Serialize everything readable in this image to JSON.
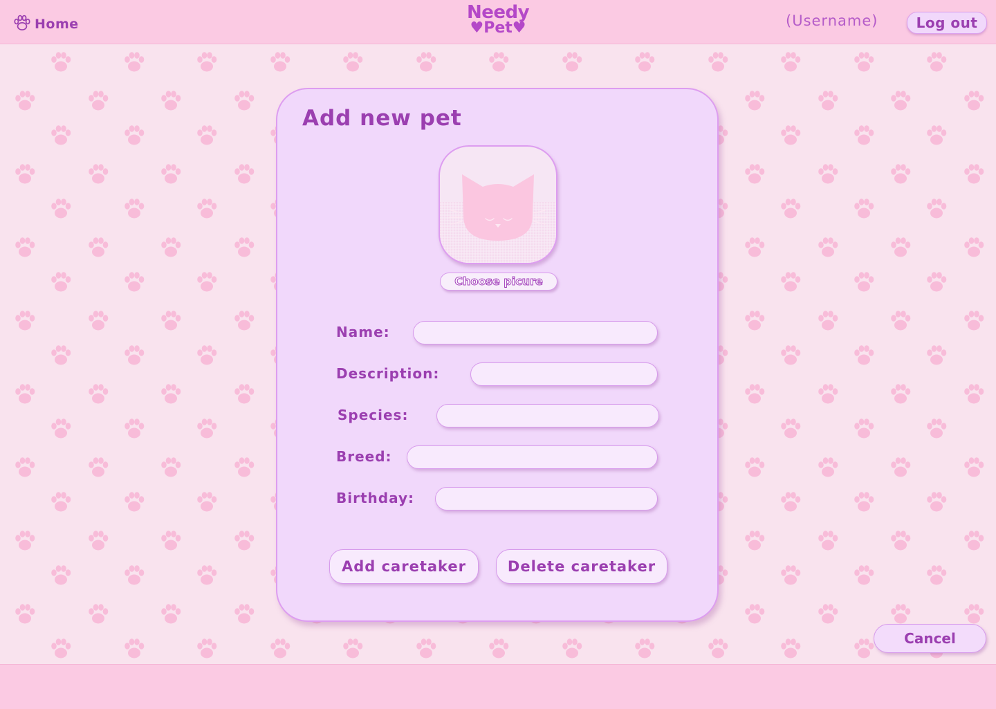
{
  "header": {
    "home_label": "Home",
    "logo_line1": "Needy",
    "logo_line2": "♥Pet♥",
    "username": "(Username)",
    "logout_label": "Log out"
  },
  "form": {
    "title": "Add new pet",
    "choose_picture_label": "Choose picure",
    "fields": [
      {
        "label": "Name:",
        "value": "",
        "placeholder": ""
      },
      {
        "label": "Description:",
        "value": "",
        "placeholder": ""
      },
      {
        "label": "Species:",
        "value": "",
        "placeholder": ""
      },
      {
        "label": "Breed:",
        "value": "",
        "placeholder": ""
      },
      {
        "label": "Birthday:",
        "value": "",
        "placeholder": ""
      }
    ],
    "add_caretaker_label": "Add caretaker",
    "delete_caretaker_label": "Delete caretaker"
  },
  "cancel_label": "Cancel",
  "icons": {
    "home": "paw-icon",
    "placeholder_picture": "cat-face-icon",
    "background": "paw-pattern"
  },
  "colors": {
    "header_bg": "#fbcae3",
    "page_bg": "#f9e3ee",
    "card_bg": "#f1d8fb",
    "accent_text": "#9b3fb0",
    "paw_color": "#f8bcd9",
    "border": "#dd9df0"
  }
}
